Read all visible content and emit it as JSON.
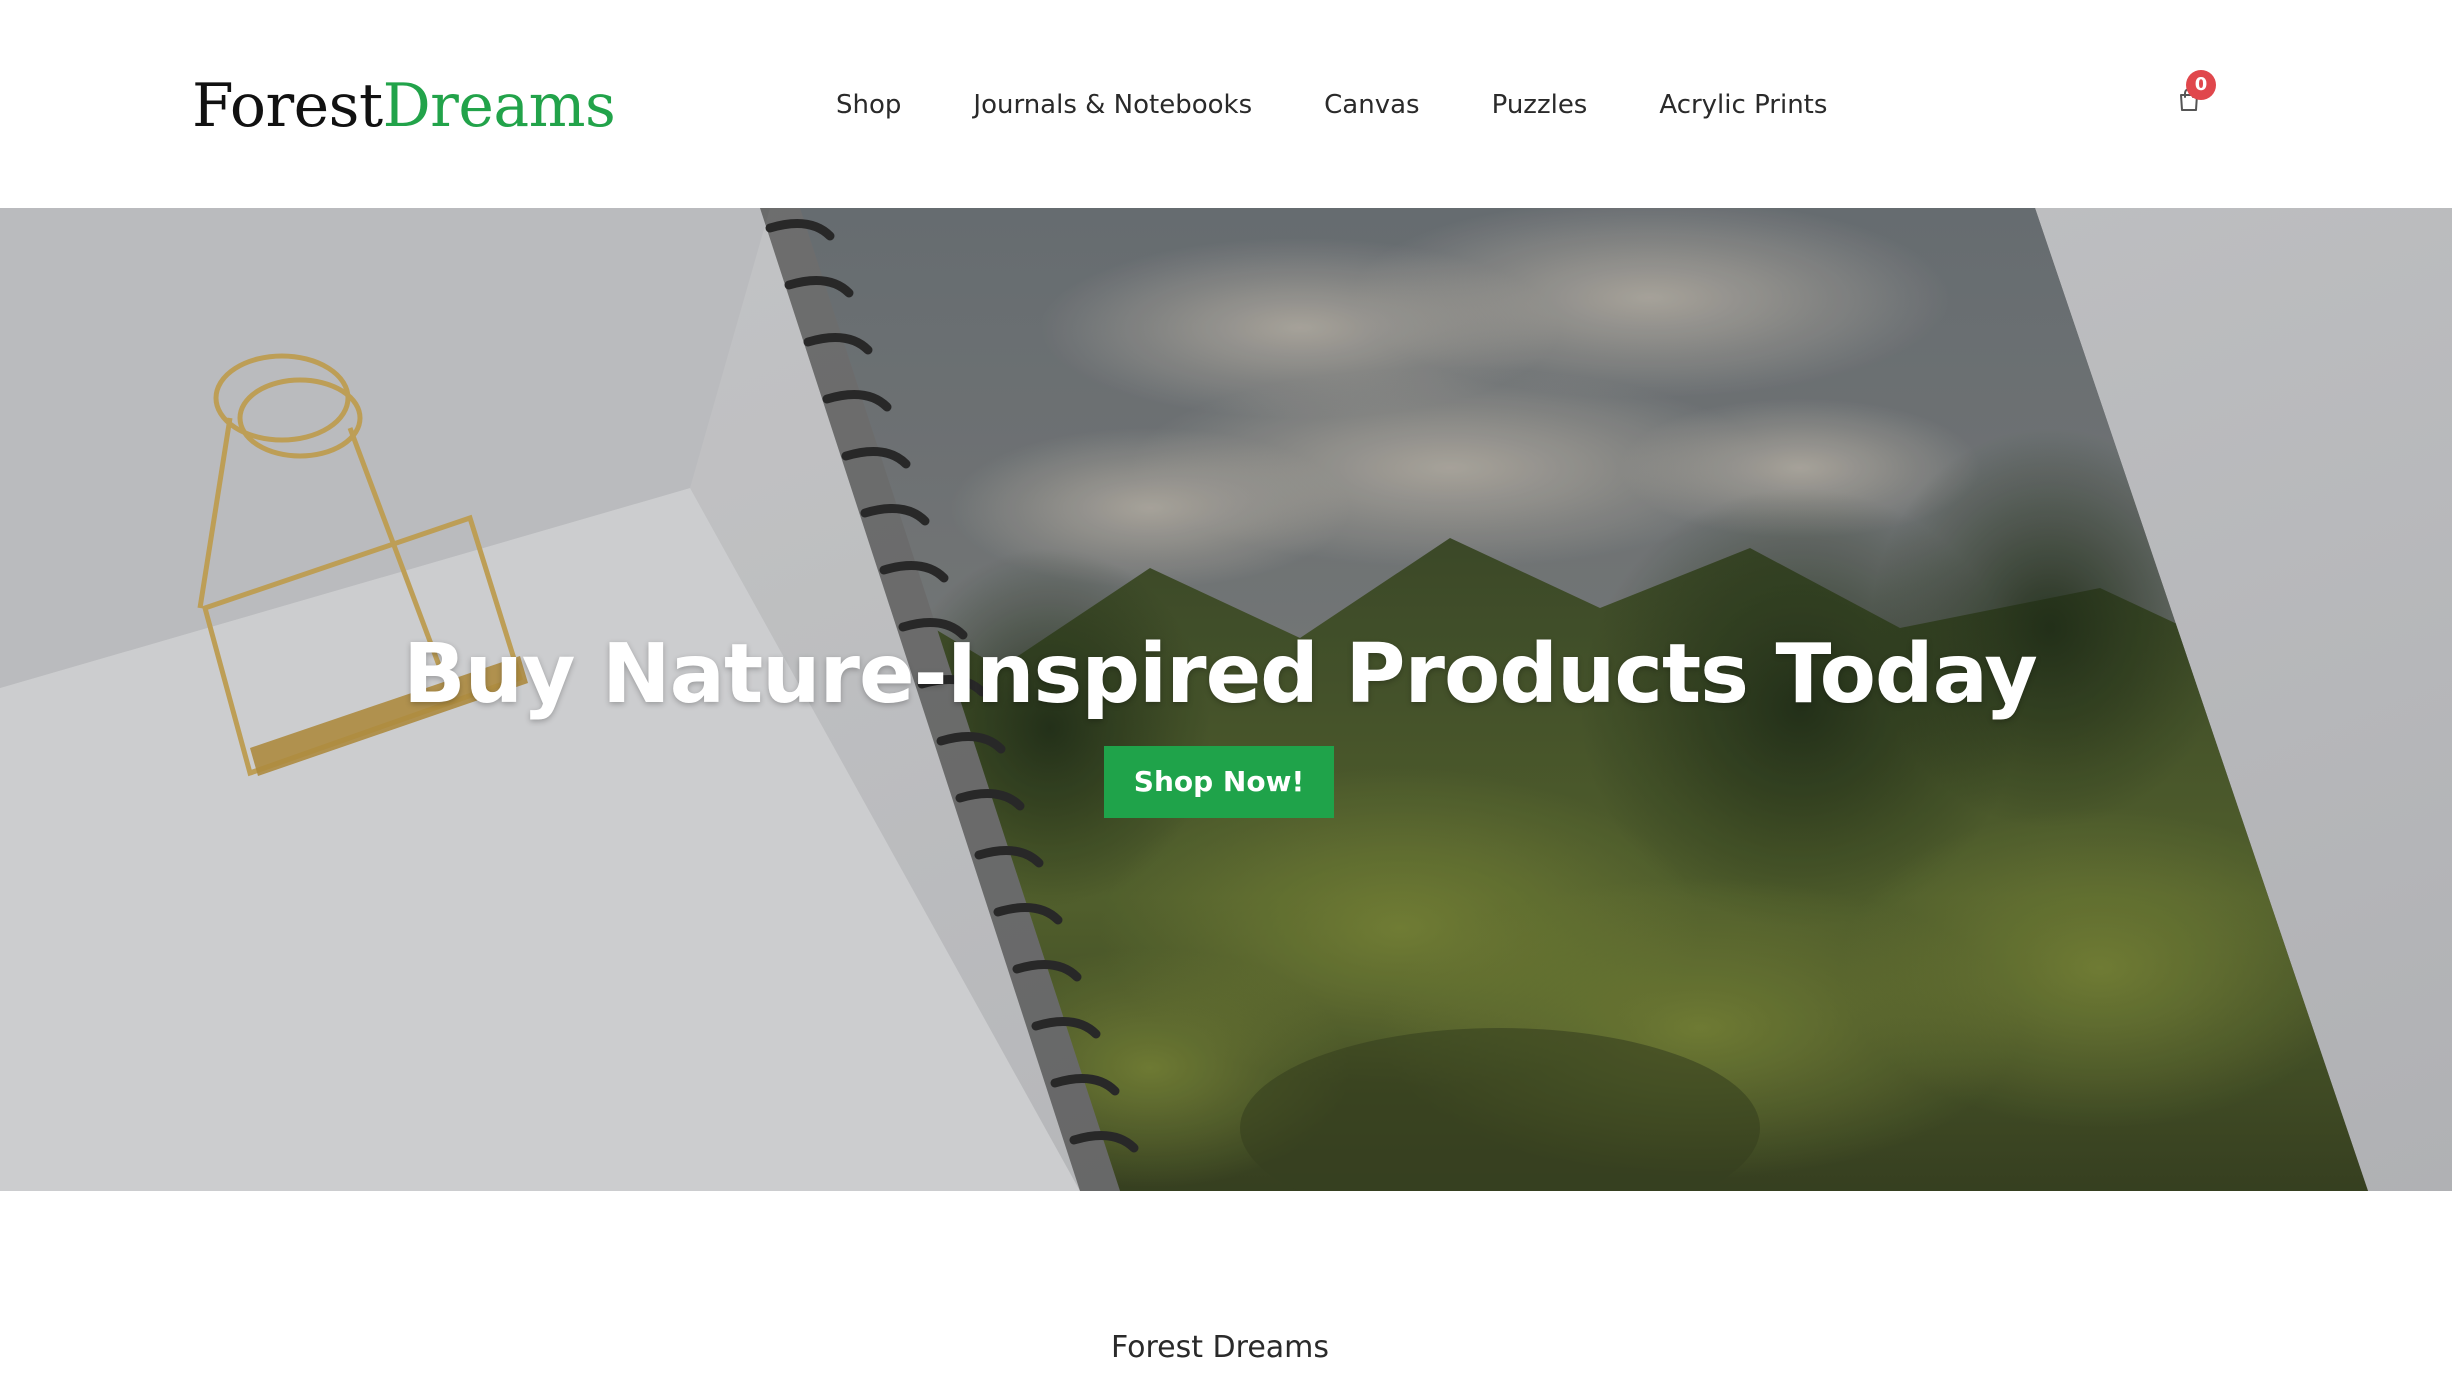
{
  "header": {
    "logo": {
      "part1": "Forest",
      "part2": "Dreams"
    },
    "nav": [
      {
        "label": "Shop"
      },
      {
        "label": "Journals & Notebooks"
      },
      {
        "label": "Canvas"
      },
      {
        "label": "Puzzles"
      },
      {
        "label": "Acrylic Prints"
      }
    ],
    "cart": {
      "icon": "shopping-bag-icon",
      "count": "0"
    }
  },
  "hero": {
    "title": "Buy Nature-Inspired Products Today",
    "button_label": "Shop Now!"
  },
  "section": {
    "site_name": "Forest Dreams"
  },
  "colors": {
    "brand_green": "#22a34a",
    "button_green": "#1fa34a",
    "badge_red": "#e0474c"
  }
}
